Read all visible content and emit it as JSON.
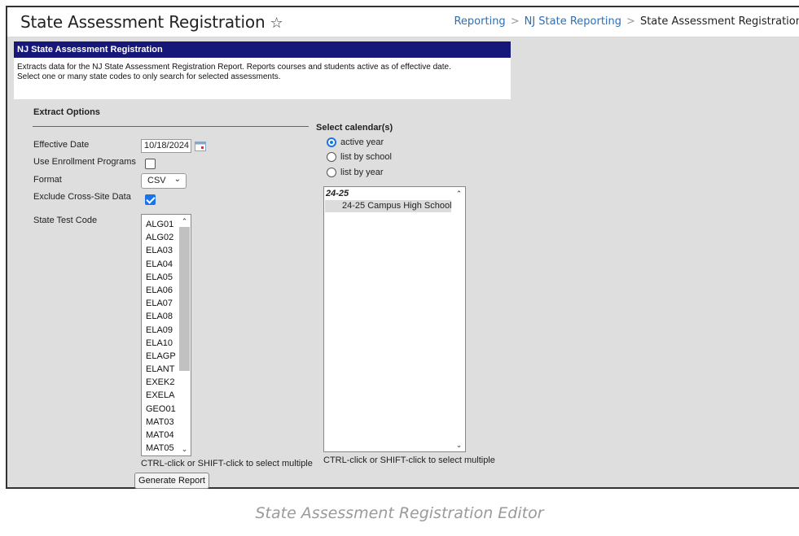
{
  "header": {
    "title": "State Assessment Registration",
    "star_icon": "☆",
    "breadcrumb": [
      "Reporting",
      "NJ State Reporting",
      "State Assessment Registration"
    ]
  },
  "panel": {
    "title": "NJ State Assessment Registration",
    "description_line1": "Extracts data for the NJ State Assessment Registration Report. Reports courses and students active as of effective date.",
    "description_line2": "Select one or many state codes to only search for selected assessments."
  },
  "extract_options": {
    "heading": "Extract Options",
    "effective_date_label": "Effective Date",
    "effective_date_value": "10/18/2024",
    "use_enrollment_label": "Use Enrollment Programs",
    "use_enrollment_checked": false,
    "format_label": "Format",
    "format_value": "CSV",
    "exclude_cross_site_label": "Exclude Cross-Site Data",
    "exclude_cross_site_checked": true,
    "state_test_code_label": "State Test Code",
    "state_test_codes": [
      "ALG01",
      "ALG02",
      "ELA03",
      "ELA04",
      "ELA05",
      "ELA06",
      "ELA07",
      "ELA08",
      "ELA09",
      "ELA10",
      "ELAGP",
      "ELANT",
      "EXEK2",
      "EXELA",
      "GEO01",
      "MAT03",
      "MAT04",
      "MAT05"
    ],
    "multi_select_hint": "CTRL-click or SHIFT-click to select multiple"
  },
  "calendars": {
    "heading": "Select calendar(s)",
    "options": [
      {
        "label": "active year",
        "selected": true
      },
      {
        "label": "list by school",
        "selected": false
      },
      {
        "label": "list by year",
        "selected": false
      }
    ],
    "group_label": "24-25",
    "items": [
      "24-25 Campus High School"
    ],
    "multi_select_hint": "CTRL-click or SHIFT-click to select multiple"
  },
  "generate_button": "Generate Report",
  "caption": "State Assessment Registration Editor",
  "colors": {
    "panel_header_bg": "#17177a",
    "link": "#2a6fb8",
    "accent": "#1a73e8",
    "content_bg": "#dedede"
  }
}
